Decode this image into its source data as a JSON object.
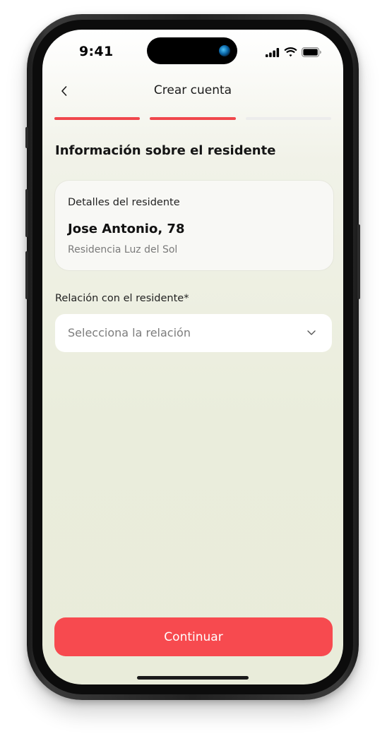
{
  "status_bar": {
    "time": "9:41",
    "icons": [
      "cellular-signal-icon",
      "wifi-icon",
      "battery-icon"
    ]
  },
  "header": {
    "title": "Crear cuenta",
    "back_icon": "chevron-left-icon"
  },
  "progress": {
    "total_steps": 3,
    "completed_steps": 2,
    "active_color": "#f0474c",
    "inactive_color": "#ececec"
  },
  "section": {
    "title": "Información sobre el residente"
  },
  "resident_card": {
    "label": "Detalles del residente",
    "name": "Jose Antonio, 78",
    "residence": "Residencia Luz del Sol"
  },
  "relation_field": {
    "label": "Relación con el residente*",
    "placeholder": "Selecciona la relación",
    "chevron_icon": "chevron-down-icon"
  },
  "actions": {
    "continue_label": "Continuar",
    "continue_color": "#f74a4f"
  },
  "colors": {
    "background": "#eaeddc",
    "accent": "#f0474c"
  }
}
